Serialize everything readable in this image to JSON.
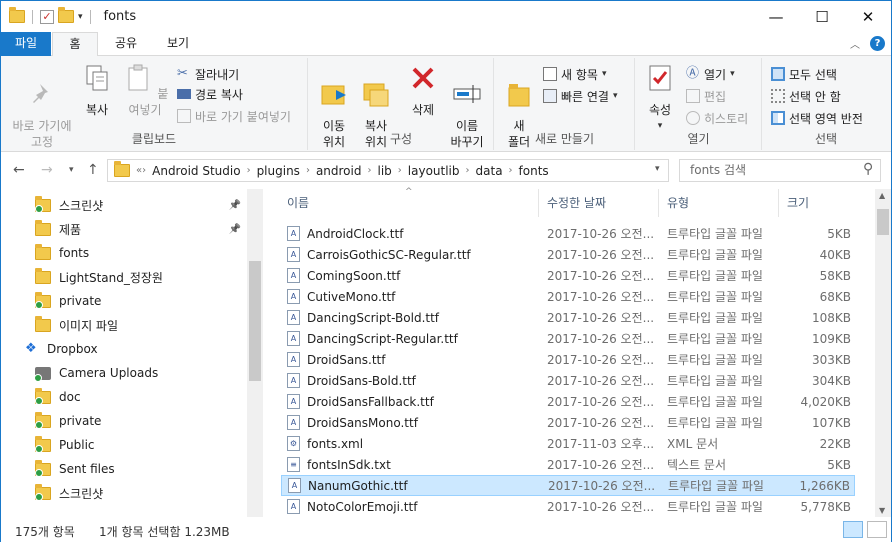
{
  "window": {
    "title": "fonts"
  },
  "tabs": {
    "file": "파일",
    "home": "홈",
    "share": "공유",
    "view": "보기"
  },
  "ribbon": {
    "clipboard": {
      "label": "클립보드",
      "pin": "바로 가기에\n고정",
      "copy": "복사",
      "paste": "붙여넣기",
      "cut": "잘라내기",
      "copy_path": "경로 복사",
      "paste_shortcut": "바로 가기 붙여넣기"
    },
    "organize": {
      "label": "구성",
      "move_to": "이동\n위치",
      "copy_to": "복사\n위치",
      "delete": "삭제",
      "rename": "이름\n바꾸기"
    },
    "new": {
      "label": "새로 만들기",
      "new_folder": "새\n폴더",
      "new_item": "새 항목",
      "easy_access": "빠른 연결"
    },
    "open": {
      "label": "열기",
      "properties": "속성",
      "open": "열기",
      "edit": "편집",
      "history": "히스토리"
    },
    "select": {
      "label": "선택",
      "select_all": "모두 선택",
      "select_none": "선택 안 함",
      "invert": "선택 영역 반전"
    }
  },
  "address": {
    "crumbs": [
      "Android Studio",
      "plugins",
      "android",
      "lib",
      "layoutlib",
      "data",
      "fonts"
    ],
    "search_placeholder": "fonts 검색"
  },
  "nav": [
    {
      "label": "스크린샷",
      "pinned": true,
      "synced": true
    },
    {
      "label": "제품",
      "pinned": true,
      "synced": false
    },
    {
      "label": "fonts",
      "pinned": false,
      "synced": false
    },
    {
      "label": "LightStand_정장원",
      "pinned": false,
      "synced": false
    },
    {
      "label": "private",
      "pinned": false,
      "synced": true
    },
    {
      "label": "이미지 파일",
      "pinned": false,
      "synced": false
    },
    {
      "label": "Dropbox",
      "pinned": false,
      "synced": false
    },
    {
      "label": "Camera Uploads",
      "pinned": false,
      "synced": true
    },
    {
      "label": "doc",
      "pinned": false,
      "synced": true
    },
    {
      "label": "private",
      "pinned": false,
      "synced": true
    },
    {
      "label": "Public",
      "pinned": false,
      "synced": true
    },
    {
      "label": "Sent files",
      "pinned": false,
      "synced": true
    },
    {
      "label": "스크린샷",
      "pinned": false,
      "synced": true
    }
  ],
  "columns": {
    "name": "이름",
    "date": "수정한 날짜",
    "type": "유형",
    "size": "크기"
  },
  "files": [
    {
      "name": "AndroidClock.ttf",
      "date": "2017-10-26 오전...",
      "type": "트루타입 글꼴 파일",
      "size": "5KB"
    },
    {
      "name": "CarroisGothicSC-Regular.ttf",
      "date": "2017-10-26 오전...",
      "type": "트루타입 글꼴 파일",
      "size": "40KB"
    },
    {
      "name": "ComingSoon.ttf",
      "date": "2017-10-26 오전...",
      "type": "트루타입 글꼴 파일",
      "size": "58KB"
    },
    {
      "name": "CutiveMono.ttf",
      "date": "2017-10-26 오전...",
      "type": "트루타입 글꼴 파일",
      "size": "68KB"
    },
    {
      "name": "DancingScript-Bold.ttf",
      "date": "2017-10-26 오전...",
      "type": "트루타입 글꼴 파일",
      "size": "108KB"
    },
    {
      "name": "DancingScript-Regular.ttf",
      "date": "2017-10-26 오전...",
      "type": "트루타입 글꼴 파일",
      "size": "109KB"
    },
    {
      "name": "DroidSans.ttf",
      "date": "2017-10-26 오전...",
      "type": "트루타입 글꼴 파일",
      "size": "303KB"
    },
    {
      "name": "DroidSans-Bold.ttf",
      "date": "2017-10-26 오전...",
      "type": "트루타입 글꼴 파일",
      "size": "304KB"
    },
    {
      "name": "DroidSansFallback.ttf",
      "date": "2017-10-26 오전...",
      "type": "트루타입 글꼴 파일",
      "size": "4,020KB"
    },
    {
      "name": "DroidSansMono.ttf",
      "date": "2017-10-26 오전...",
      "type": "트루타입 글꼴 파일",
      "size": "107KB"
    },
    {
      "name": "fonts.xml",
      "date": "2017-11-03 오후...",
      "type": "XML 문서",
      "size": "22KB"
    },
    {
      "name": "fontsInSdk.txt",
      "date": "2017-10-26 오전...",
      "type": "텍스트 문서",
      "size": "5KB"
    },
    {
      "name": "NanumGothic.ttf",
      "date": "2017-10-26 오전...",
      "type": "트루타입 글꼴 파일",
      "size": "1,266KB",
      "selected": true
    },
    {
      "name": "NotoColorEmoji.ttf",
      "date": "2017-10-26 오전...",
      "type": "트루타입 글꼴 파일",
      "size": "5,778KB"
    }
  ],
  "status": {
    "count": "175개 항목",
    "selection": "1개 항목 선택함 1.23MB"
  }
}
